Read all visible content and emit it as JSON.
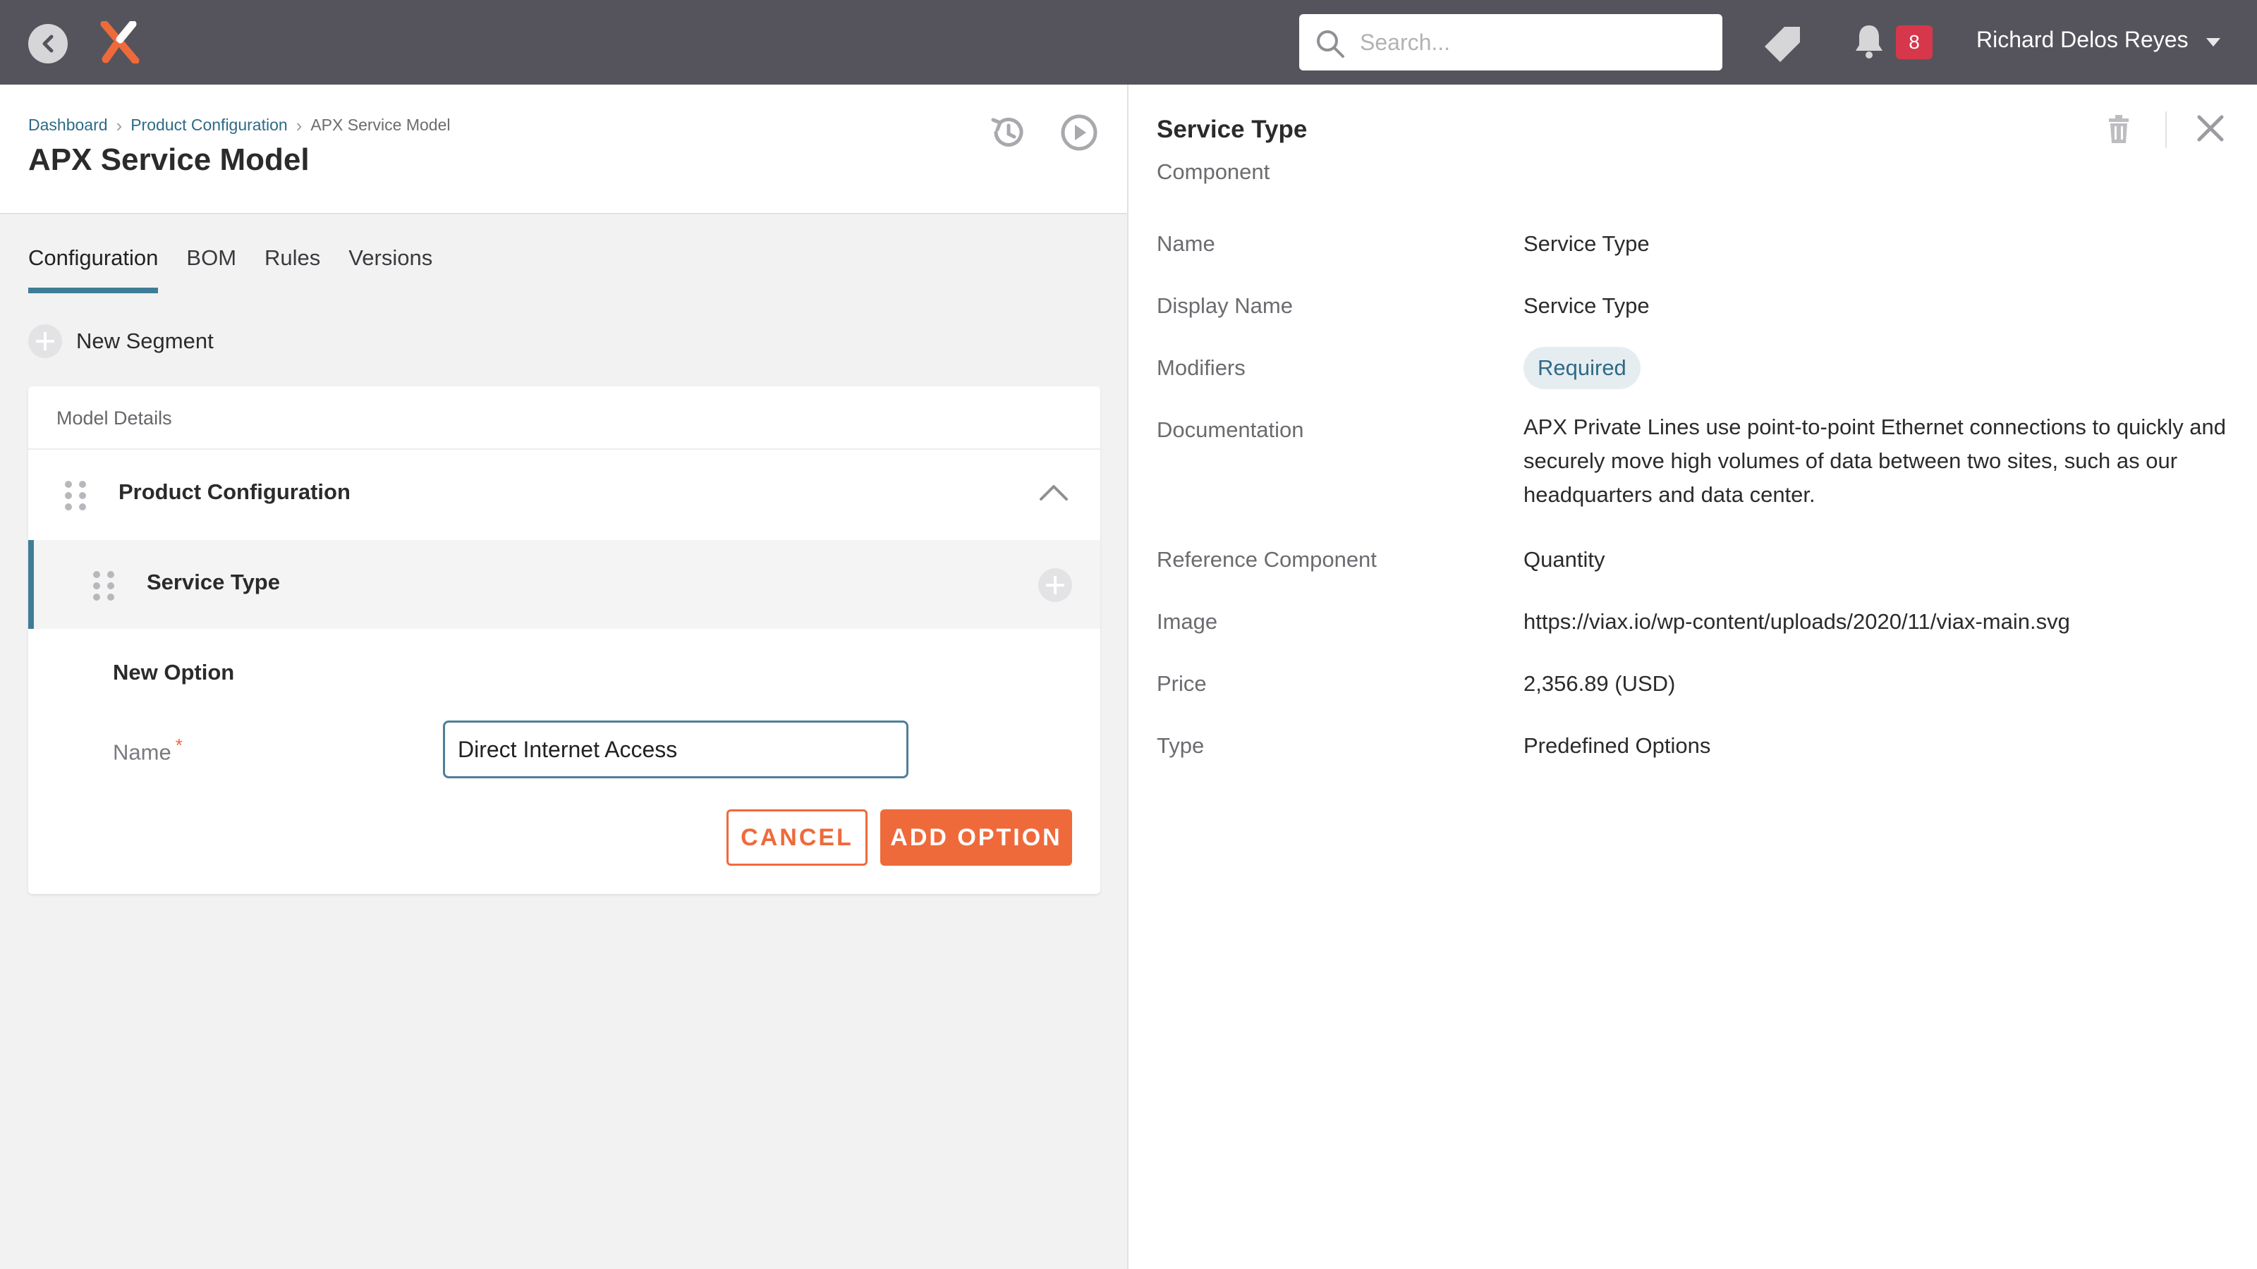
{
  "topbar": {
    "search_placeholder": "Search...",
    "notification_count": "8",
    "user_name": "Richard Delos Reyes"
  },
  "colors": {
    "topbar_bg": "#55545c",
    "accent_orange": "#ef6a3b",
    "accent_teal": "#3f7d97",
    "badge_red": "#d7374b"
  },
  "header": {
    "breadcrumb": [
      "Dashboard",
      "Product Configuration",
      "APX Service Model"
    ],
    "title": "APX Service Model"
  },
  "tabs": [
    {
      "label": "Configuration",
      "active": true
    },
    {
      "label": "BOM",
      "active": false
    },
    {
      "label": "Rules",
      "active": false
    },
    {
      "label": "Versions",
      "active": false
    }
  ],
  "new_segment_label": "New Segment",
  "card": {
    "title": "Model Details",
    "product_row_label": "Product Configuration",
    "service_row_label": "Service Type",
    "new_option": {
      "title": "New Option",
      "name_label": "Name",
      "required_marker": "*",
      "name_value": "Direct Internet Access",
      "cancel_label": "CANCEL",
      "add_label": "ADD OPTION"
    }
  },
  "detail": {
    "title": "Service Type",
    "subtitle": "Component",
    "properties": [
      {
        "key": "Name",
        "value": "Service Type"
      },
      {
        "key": "Display Name",
        "value": "Service Type"
      },
      {
        "key": "Modifiers",
        "value": "Required"
      },
      {
        "key": "Documentation",
        "value": "APX Private Lines use point-to-point Ethernet connections to quickly and securely move high volumes of data between two sites, such as our headquarters and data center."
      },
      {
        "key": "Reference Component",
        "value": "Quantity"
      },
      {
        "key": "Image",
        "value": "https://viax.io/wp-content/uploads/2020/11/viax-main.svg"
      },
      {
        "key": "Price",
        "value": "2,356.89 (USD)"
      },
      {
        "key": "Type",
        "value": "Predefined Options"
      }
    ]
  }
}
